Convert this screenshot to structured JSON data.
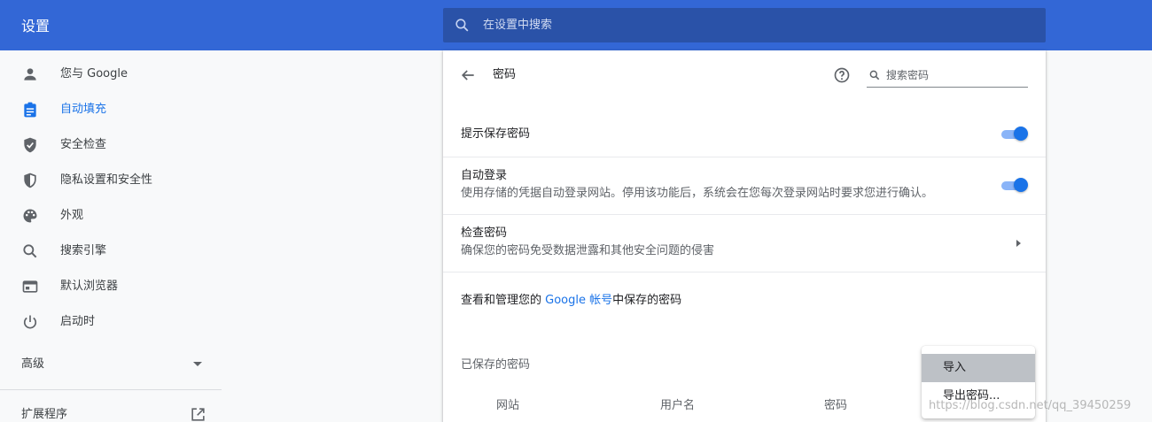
{
  "header": {
    "title": "设置",
    "search_placeholder": "在设置中搜索"
  },
  "sidebar": {
    "items": [
      {
        "label": "您与 Google",
        "icon": "person-icon"
      },
      {
        "label": "自动填充",
        "icon": "clipboard-icon",
        "active": true
      },
      {
        "label": "安全检查",
        "icon": "shield-check-icon"
      },
      {
        "label": "隐私设置和安全性",
        "icon": "shield-half-icon"
      },
      {
        "label": "外观",
        "icon": "palette-icon"
      },
      {
        "label": "搜索引擎",
        "icon": "search-icon"
      },
      {
        "label": "默认浏览器",
        "icon": "browser-window-icon"
      },
      {
        "label": "启动时",
        "icon": "power-icon"
      }
    ],
    "advanced_label": "高级",
    "extensions_label": "扩展程序"
  },
  "passwords": {
    "title": "密码",
    "search_placeholder": "搜索密码",
    "offer_save": {
      "title": "提示保存密码",
      "enabled": true
    },
    "auto_signin": {
      "title": "自动登录",
      "description": "使用存储的凭据自动登录网站。停用该功能后，系统会在您每次登录网站时要求您进行确认。",
      "enabled": true
    },
    "check": {
      "title": "检查密码",
      "description": "确保您的密码免受数据泄露和其他安全问题的侵害"
    },
    "manage": {
      "prefix": "查看和管理您的 ",
      "link": "Google 帐号",
      "suffix": "中保存的密码"
    },
    "saved_title": "已保存的密码",
    "columns": [
      "网站",
      "用户名",
      "密码"
    ]
  },
  "menu": {
    "items": [
      {
        "label": "导入",
        "highlighted": true
      },
      {
        "label": "导出密码..."
      }
    ]
  },
  "watermark": "https://blog.csdn.net/qq_39450259",
  "colors": {
    "header": "#3367d6",
    "accent": "#1a73e8",
    "background": "#f8f9fa"
  }
}
